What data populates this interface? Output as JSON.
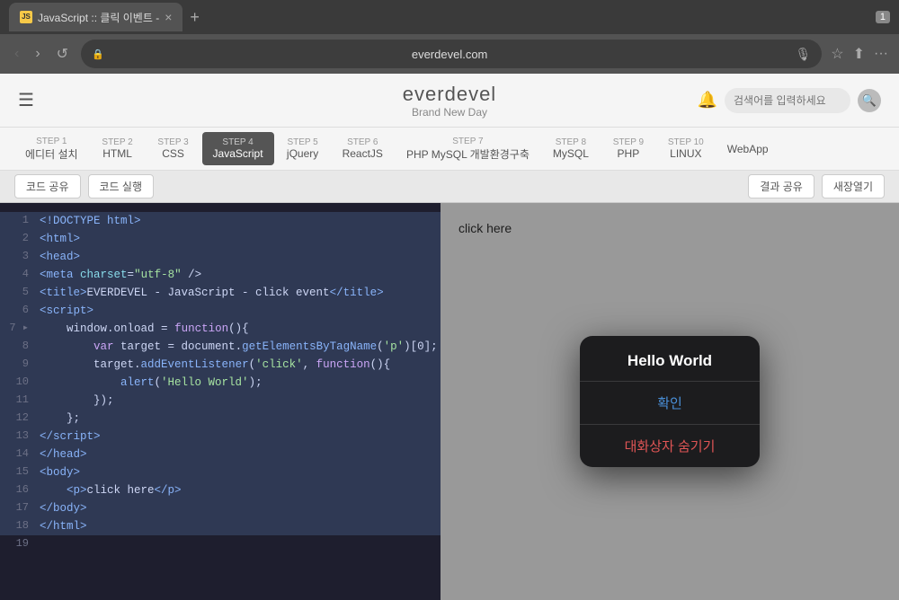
{
  "browser": {
    "tab_favicon": "JS",
    "tab_title": "JavaScript :: 클릭 이벤트 -",
    "tab_close": "×",
    "new_tab": "+",
    "tab_number": "1",
    "nav_back": "‹",
    "nav_forward": "›",
    "nav_refresh": "↺",
    "url": "everdevel.com",
    "lock_icon": "🔒",
    "mic_icon": "🎤",
    "bookmark_icon": "☆",
    "share_icon": "⬆",
    "more_icon": "···"
  },
  "site": {
    "hamburger": "☰",
    "name": "everdevel",
    "tagline": "Brand New Day",
    "bell": "🔔",
    "search_placeholder": "검색어를 입력하세요",
    "search_btn": "🔍"
  },
  "steps": [
    {
      "num": "STEP 1",
      "label": "에디터 설치",
      "active": false
    },
    {
      "num": "STEP 2",
      "label": "HTML",
      "active": false
    },
    {
      "num": "STEP 3",
      "label": "CSS",
      "active": false
    },
    {
      "num": "STEP 4",
      "label": "JavaScript",
      "active": true
    },
    {
      "num": "STEP 5",
      "label": "jQuery",
      "active": false
    },
    {
      "num": "STEP 6",
      "label": "ReactJS",
      "active": false
    },
    {
      "num": "STEP 7",
      "label": "PHP MySQL 개발환경구축",
      "active": false
    },
    {
      "num": "STEP 8",
      "label": "MySQL",
      "active": false
    },
    {
      "num": "STEP 9",
      "label": "PHP",
      "active": false
    },
    {
      "num": "STEP 10",
      "label": "LINUX",
      "active": false
    },
    {
      "num": "",
      "label": "WebApp",
      "active": false
    }
  ],
  "toolbar": {
    "share_code": "코드 공유",
    "run_code": "코드 실행",
    "result_share": "결과 공유",
    "new_write": "새장열기"
  },
  "code_lines": [
    {
      "num": 1,
      "content": "<!DOCTYPE html>"
    },
    {
      "num": 2,
      "content": "<html>"
    },
    {
      "num": 3,
      "content": "<head>"
    },
    {
      "num": 4,
      "content": "  <meta charset=\"utf-8\" />"
    },
    {
      "num": 5,
      "content": "  <title>EVERDEVEL - JavaScript - click event</title>"
    },
    {
      "num": 6,
      "content": "  <script>"
    },
    {
      "num": 7,
      "content": "    window.onload = function(){"
    },
    {
      "num": 8,
      "content": "      var target = document.getElementsByTagName('p')[0];"
    },
    {
      "num": 9,
      "content": "      target.addEventListener('click', function(){"
    },
    {
      "num": 10,
      "content": "          alert('Hello World');"
    },
    {
      "num": 11,
      "content": "      });"
    },
    {
      "num": 12,
      "content": "    };"
    },
    {
      "num": 13,
      "content": "  </script>"
    },
    {
      "num": 14,
      "content": "</head>"
    },
    {
      "num": 15,
      "content": "<body>"
    },
    {
      "num": 16,
      "content": "  <p>click here</p>"
    },
    {
      "num": 17,
      "content": "</body>"
    },
    {
      "num": 18,
      "content": "</html>"
    },
    {
      "num": 19,
      "content": ""
    }
  ],
  "preview": {
    "click_text": "click here"
  },
  "modal": {
    "title": "Hello World",
    "confirm_btn": "확인",
    "cancel_btn": "대화상자 숨기기"
  }
}
